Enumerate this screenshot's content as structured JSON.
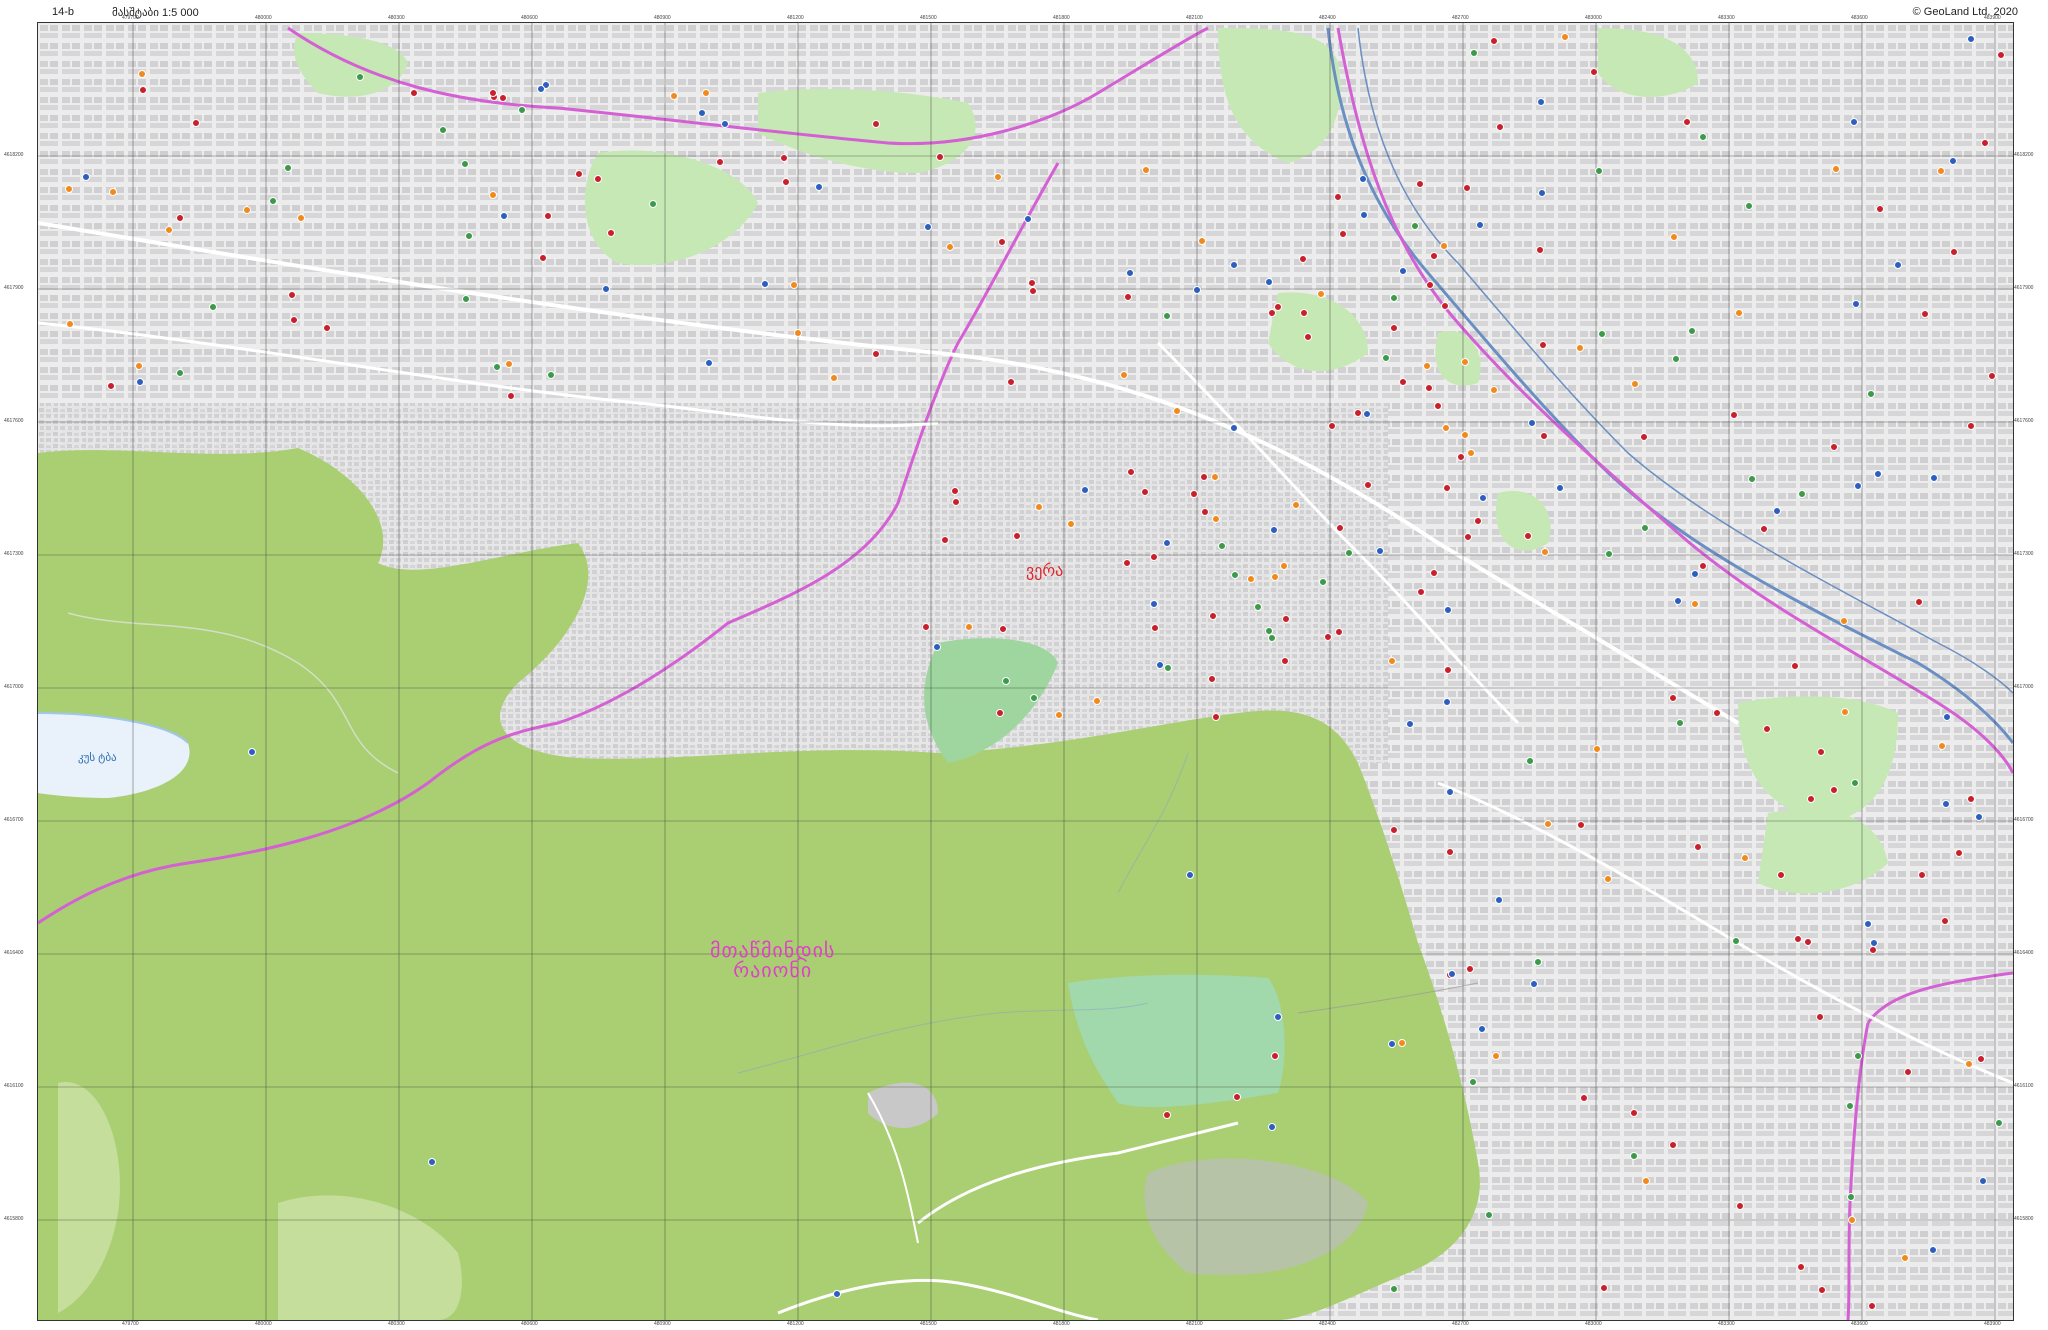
{
  "header": {
    "sheet_id": "14-b",
    "scale": "მასშტაბი 1:5 000",
    "copyright": "© GeoLand Ltd. 2020"
  },
  "map": {
    "district_label_line1": "მთაწმინდის",
    "district_label_line2": "რაიონი",
    "neighbourhood_label": "ვერა",
    "lake_label": "კუს ტბა",
    "colors": {
      "forest": "#a9cf72",
      "forest_light": "#c5de9c",
      "park": "#c6e8b4",
      "urban": "#e8e8e9",
      "road_magenta": "#d460d4",
      "river": "#6a8fc2",
      "water": "#9fc6ec",
      "poi_red": "#c8202c",
      "poi_blue": "#2d5fbf",
      "poi_orange": "#f08a1e",
      "poi_green": "#3c9a4a"
    },
    "x_ticks": [
      "479700",
      "480000",
      "480300",
      "480600",
      "480900",
      "481200",
      "481500",
      "481800",
      "482100",
      "482400",
      "482700",
      "483000",
      "483300",
      "483600",
      "483900"
    ],
    "y_ticks": [
      "4618200",
      "4617900",
      "4617600",
      "4617300",
      "4617000",
      "4616700",
      "4616400",
      "4616100",
      "4615800"
    ]
  }
}
